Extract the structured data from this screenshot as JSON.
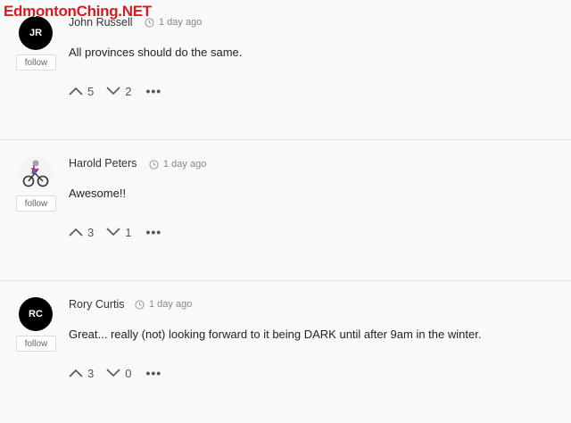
{
  "watermark": "EdmontonChing.NET",
  "follow_label": "follow",
  "more_label": "•••",
  "comments": [
    {
      "initials": "JR",
      "author": "John Russell",
      "time": "1 day ago",
      "text": "All provinces should do the same.",
      "upvotes": "5",
      "downvotes": "2"
    },
    {
      "initials": "",
      "author": "Harold Peters",
      "time": "1 day ago",
      "text": "Awesome!!",
      "upvotes": "3",
      "downvotes": "1",
      "avatar_icon": "bicycle-rider-icon"
    },
    {
      "initials": "RC",
      "author": "Rory Curtis",
      "time": "1 day ago",
      "text": "Great... really (not) looking forward to it being DARK until after 9am in the winter.",
      "upvotes": "3",
      "downvotes": "0"
    }
  ]
}
